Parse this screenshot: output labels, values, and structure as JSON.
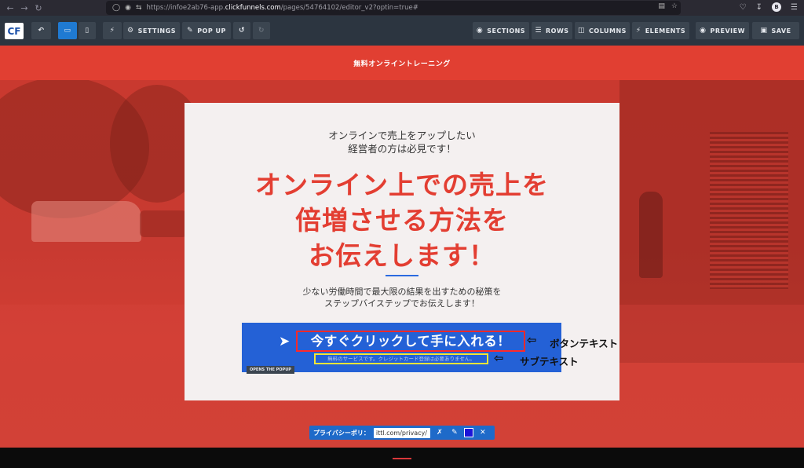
{
  "browser": {
    "url_prefix": "https://infoe2ab76-app.",
    "url_domain": "clickfunnels.com",
    "url_path": "/pages/54764102/editor_v2?optin=true#",
    "avatar": "B"
  },
  "toolbar": {
    "logo_text": "CF",
    "settings_label": "SETTINGS",
    "popup_label": "POP UP",
    "sections_label": "SECTIONS",
    "rows_label": "ROWS",
    "columns_label": "COLUMNS",
    "elements_label": "ELEMENTS",
    "preview_label": "PREVIEW",
    "save_label": "SAVE"
  },
  "page": {
    "banner": "無料オンライントレーニング",
    "lead_line1": "オンラインで売上をアップしたい",
    "lead_line2": "経営者の方は必見です！",
    "headline_line1": "オンライン上での売上を",
    "headline_line2": "倍増させる方法を",
    "headline_line3": "お伝えします！",
    "sub_line1": "少ない労働時間で最大限の結果を出すための秘策を",
    "sub_line2": "ステップバイステップでお伝えします！",
    "cta_main": "今すぐクリックして手に入れる！",
    "cta_sub": "無料のサービスです。クレジットカード登録は必要ありません。",
    "popup_tag": "OPENS THE POPUP"
  },
  "annotations": {
    "button_text": "ボタンテキスト",
    "sub_text": "サブテキスト"
  },
  "privacy": {
    "label": "プライバシーポリ：",
    "value": "ittl.com/privacy/"
  },
  "colors": {
    "brand_red": "#e13f32",
    "cta_blue": "#2461d6",
    "toolbar_bg": "#2c3540",
    "active_blue": "#1f7ad2"
  }
}
